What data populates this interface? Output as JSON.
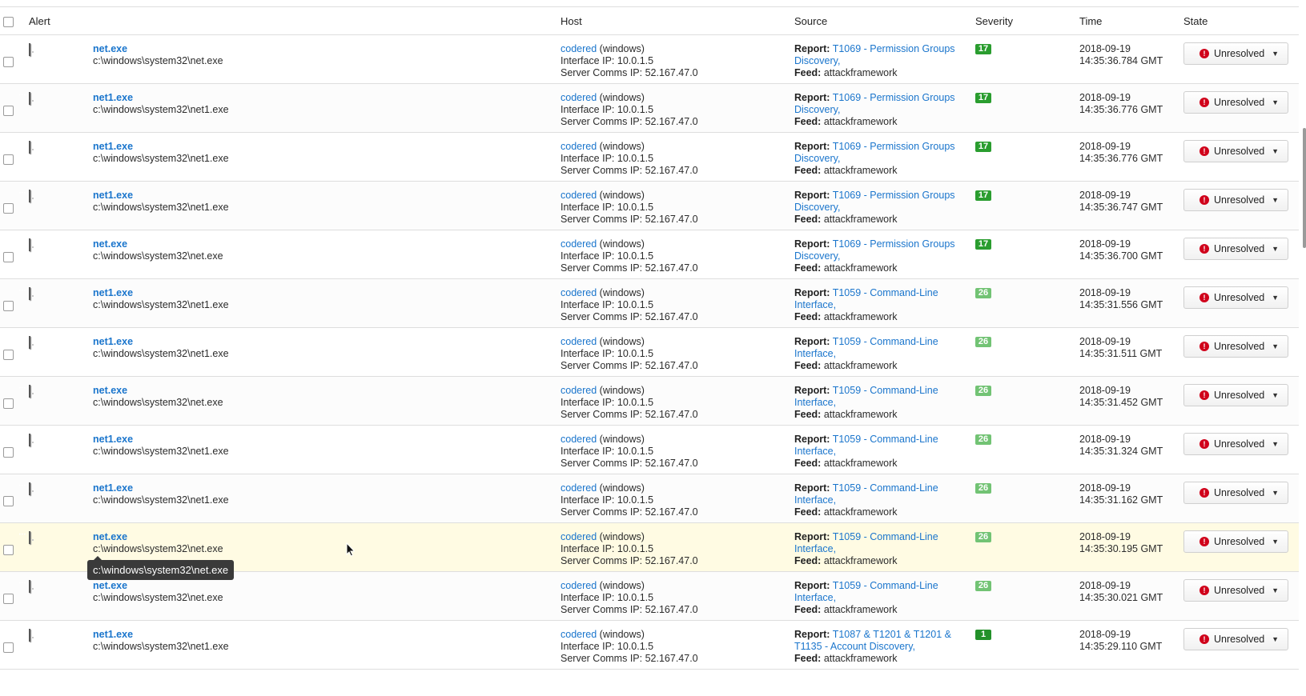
{
  "columns": {
    "alert": "Alert",
    "host": "Host",
    "source": "Source",
    "severity": "Severity",
    "time": "Time",
    "state": "State"
  },
  "labels": {
    "report": "Report:",
    "feed": "Feed:",
    "interface_ip": "Interface IP:",
    "server_ip": "Server Comms IP:",
    "host_os": "(windows)"
  },
  "colors": {
    "sev_17": "#2a9d2f",
    "sev_26": "#72c374",
    "sev_1": "#23912a",
    "link": "#1a75cc"
  },
  "tooltip": "c:\\windows\\system32\\net.exe",
  "rows": [
    {
      "name": "net.exe",
      "path": "c:\\windows\\system32\\net.exe",
      "host": "codered",
      "ip": "10.0.1.5",
      "server_ip": "52.167.47.0",
      "report_line1": "T1069 - Permission Groups",
      "report_line2": "Discovery,",
      "feed": "attackframework",
      "severity": "17",
      "date": "2018-09-19",
      "time": "14:35:36.784 GMT",
      "state": "Unresolved"
    },
    {
      "name": "net1.exe",
      "path": "c:\\windows\\system32\\net1.exe",
      "host": "codered",
      "ip": "10.0.1.5",
      "server_ip": "52.167.47.0",
      "report_line1": "T1069 - Permission Groups",
      "report_line2": "Discovery,",
      "feed": "attackframework",
      "severity": "17",
      "date": "2018-09-19",
      "time": "14:35:36.776 GMT",
      "state": "Unresolved"
    },
    {
      "name": "net1.exe",
      "path": "c:\\windows\\system32\\net1.exe",
      "host": "codered",
      "ip": "10.0.1.5",
      "server_ip": "52.167.47.0",
      "report_line1": "T1069 - Permission Groups",
      "report_line2": "Discovery,",
      "feed": "attackframework",
      "severity": "17",
      "date": "2018-09-19",
      "time": "14:35:36.776 GMT",
      "state": "Unresolved"
    },
    {
      "name": "net1.exe",
      "path": "c:\\windows\\system32\\net1.exe",
      "host": "codered",
      "ip": "10.0.1.5",
      "server_ip": "52.167.47.0",
      "report_line1": "T1069 - Permission Groups",
      "report_line2": "Discovery,",
      "feed": "attackframework",
      "severity": "17",
      "date": "2018-09-19",
      "time": "14:35:36.747 GMT",
      "state": "Unresolved"
    },
    {
      "name": "net.exe",
      "path": "c:\\windows\\system32\\net.exe",
      "host": "codered",
      "ip": "10.0.1.5",
      "server_ip": "52.167.47.0",
      "report_line1": "T1069 - Permission Groups",
      "report_line2": "Discovery,",
      "feed": "attackframework",
      "severity": "17",
      "date": "2018-09-19",
      "time": "14:35:36.700 GMT",
      "state": "Unresolved"
    },
    {
      "name": "net1.exe",
      "path": "c:\\windows\\system32\\net1.exe",
      "host": "codered",
      "ip": "10.0.1.5",
      "server_ip": "52.167.47.0",
      "report_line1": "T1059 - Command-Line",
      "report_line2": "Interface,",
      "feed": "attackframework",
      "severity": "26",
      "date": "2018-09-19",
      "time": "14:35:31.556 GMT",
      "state": "Unresolved"
    },
    {
      "name": "net1.exe",
      "path": "c:\\windows\\system32\\net1.exe",
      "host": "codered",
      "ip": "10.0.1.5",
      "server_ip": "52.167.47.0",
      "report_line1": "T1059 - Command-Line",
      "report_line2": "Interface,",
      "feed": "attackframework",
      "severity": "26",
      "date": "2018-09-19",
      "time": "14:35:31.511 GMT",
      "state": "Unresolved"
    },
    {
      "name": "net.exe",
      "path": "c:\\windows\\system32\\net.exe",
      "host": "codered",
      "ip": "10.0.1.5",
      "server_ip": "52.167.47.0",
      "report_line1": "T1059 - Command-Line",
      "report_line2": "Interface,",
      "feed": "attackframework",
      "severity": "26",
      "date": "2018-09-19",
      "time": "14:35:31.452 GMT",
      "state": "Unresolved"
    },
    {
      "name": "net1.exe",
      "path": "c:\\windows\\system32\\net1.exe",
      "host": "codered",
      "ip": "10.0.1.5",
      "server_ip": "52.167.47.0",
      "report_line1": "T1059 - Command-Line",
      "report_line2": "Interface,",
      "feed": "attackframework",
      "severity": "26",
      "date": "2018-09-19",
      "time": "14:35:31.324 GMT",
      "state": "Unresolved"
    },
    {
      "name": "net1.exe",
      "path": "c:\\windows\\system32\\net1.exe",
      "host": "codered",
      "ip": "10.0.1.5",
      "server_ip": "52.167.47.0",
      "report_line1": "T1059 - Command-Line",
      "report_line2": "Interface,",
      "feed": "attackframework",
      "severity": "26",
      "date": "2018-09-19",
      "time": "14:35:31.162 GMT",
      "state": "Unresolved"
    },
    {
      "name": "net.exe",
      "path": "c:\\windows\\system32\\net.exe",
      "host": "codered",
      "ip": "10.0.1.5",
      "server_ip": "52.167.47.0",
      "report_line1": "T1059 - Command-Line",
      "report_line2": "Interface,",
      "feed": "attackframework",
      "severity": "26",
      "date": "2018-09-19",
      "time": "14:35:30.195 GMT",
      "state": "Unresolved"
    },
    {
      "name": "net.exe",
      "path": "c:\\windows\\system32\\net.exe",
      "host": "codered",
      "ip": "10.0.1.5",
      "server_ip": "52.167.47.0",
      "report_line1": "T1059 - Command-Line",
      "report_line2": "Interface,",
      "feed": "attackframework",
      "severity": "26",
      "date": "2018-09-19",
      "time": "14:35:30.021 GMT",
      "state": "Unresolved"
    },
    {
      "name": "net1.exe",
      "path": "c:\\windows\\system32\\net1.exe",
      "host": "codered",
      "ip": "10.0.1.5",
      "server_ip": "52.167.47.0",
      "report_line1": "T1087 & T1201 & T1201 &",
      "report_line2": "T1135 - Account Discovery,",
      "feed": "attackframework",
      "severity": "1",
      "date": "2018-09-19",
      "time": "14:35:29.110 GMT",
      "state": "Unresolved"
    }
  ]
}
